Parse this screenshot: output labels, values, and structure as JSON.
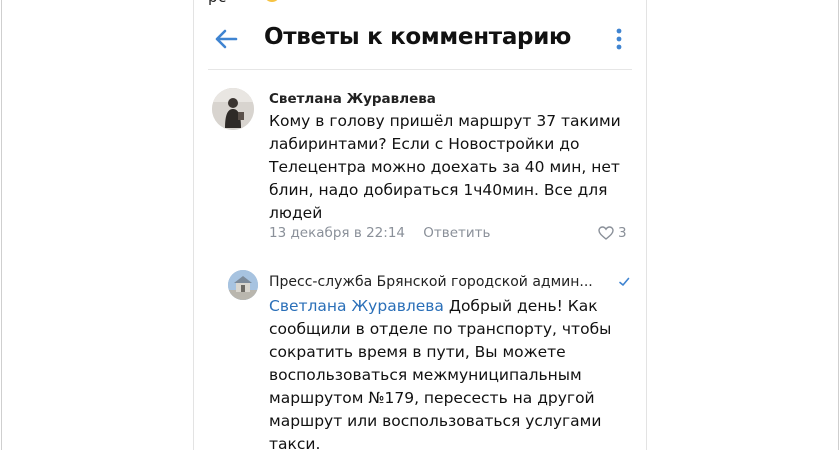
{
  "header": {
    "title": "Ответы к комментарию",
    "back_icon": "arrow-left-icon",
    "more_icon": "vertical-dots-icon",
    "accent": "#3f84d1"
  },
  "top_fragment": "рс",
  "comment": {
    "author": "Светлана Журавлева",
    "text": "Кому в голову пришёл маршрут 37 такими лабиринтами? Если с Новостройки до Телецентра можно доехать за 40 мин, нет блин, надо добираться 1ч40мин. Все для людей",
    "date": "13 декабря в 22:14",
    "reply_label": "Ответить",
    "likes": "3"
  },
  "reply": {
    "author": "Пресс-служба Брянской городской админ...",
    "mention": "Светлана Журавлева",
    "text": " Добрый день! Как сообщили в отделе по транспорту, чтобы сократить время в пути, Вы можете воспользоваться межмуниципальным маршрутом №179, пересесть на другой маршрут или воспользоваться услугами такси.",
    "verified_color": "#3f84d1"
  }
}
